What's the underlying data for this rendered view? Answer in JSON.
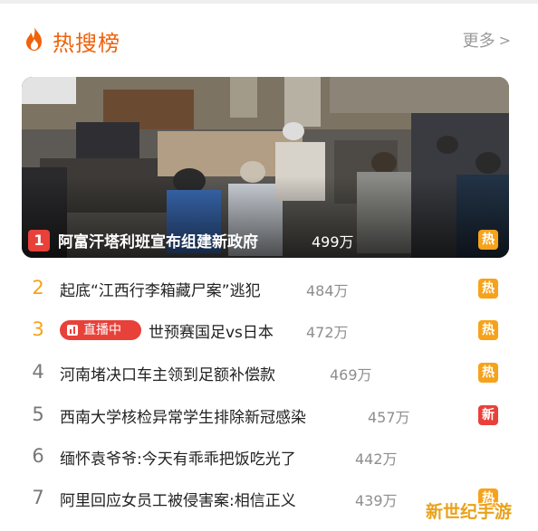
{
  "header": {
    "title": "热搜榜",
    "more_label": "更多",
    "more_chevron": ">"
  },
  "hero": {
    "rank": "1",
    "title": "阿富汗塔利班宣布组建新政府",
    "count": "499万",
    "badge": "热",
    "image_icon": "press-conference-photo"
  },
  "items": [
    {
      "rank": "2",
      "text": "起底“江西行李箱藏尸案”逃犯",
      "count": "484万",
      "badge": "热"
    },
    {
      "rank": "3",
      "live_tag": "直播中",
      "text": "世预赛国足vs日本",
      "count": "472万",
      "badge": "热"
    },
    {
      "rank": "4",
      "text": "河南堵决口车主领到足额补偿款",
      "count": "469万",
      "badge": "热"
    },
    {
      "rank": "5",
      "text": "西南大学核检异常学生排除新冠感染",
      "count": "457万",
      "badge": "新"
    },
    {
      "rank": "6",
      "text": "缅怀袁爷爷:今天有乖乖把饭吃光了",
      "count": "442万",
      "badge": ""
    },
    {
      "rank": "7",
      "text": "阿里回应女员工被侵害案:相信正义",
      "count": "439万",
      "badge": "热"
    }
  ],
  "watermark": "新世纪手游",
  "colors": {
    "accent_orange": "#f0620a",
    "hot_badge": "#f7a21b",
    "new_badge": "#e8413a",
    "rank_top": "#f7a21b"
  }
}
